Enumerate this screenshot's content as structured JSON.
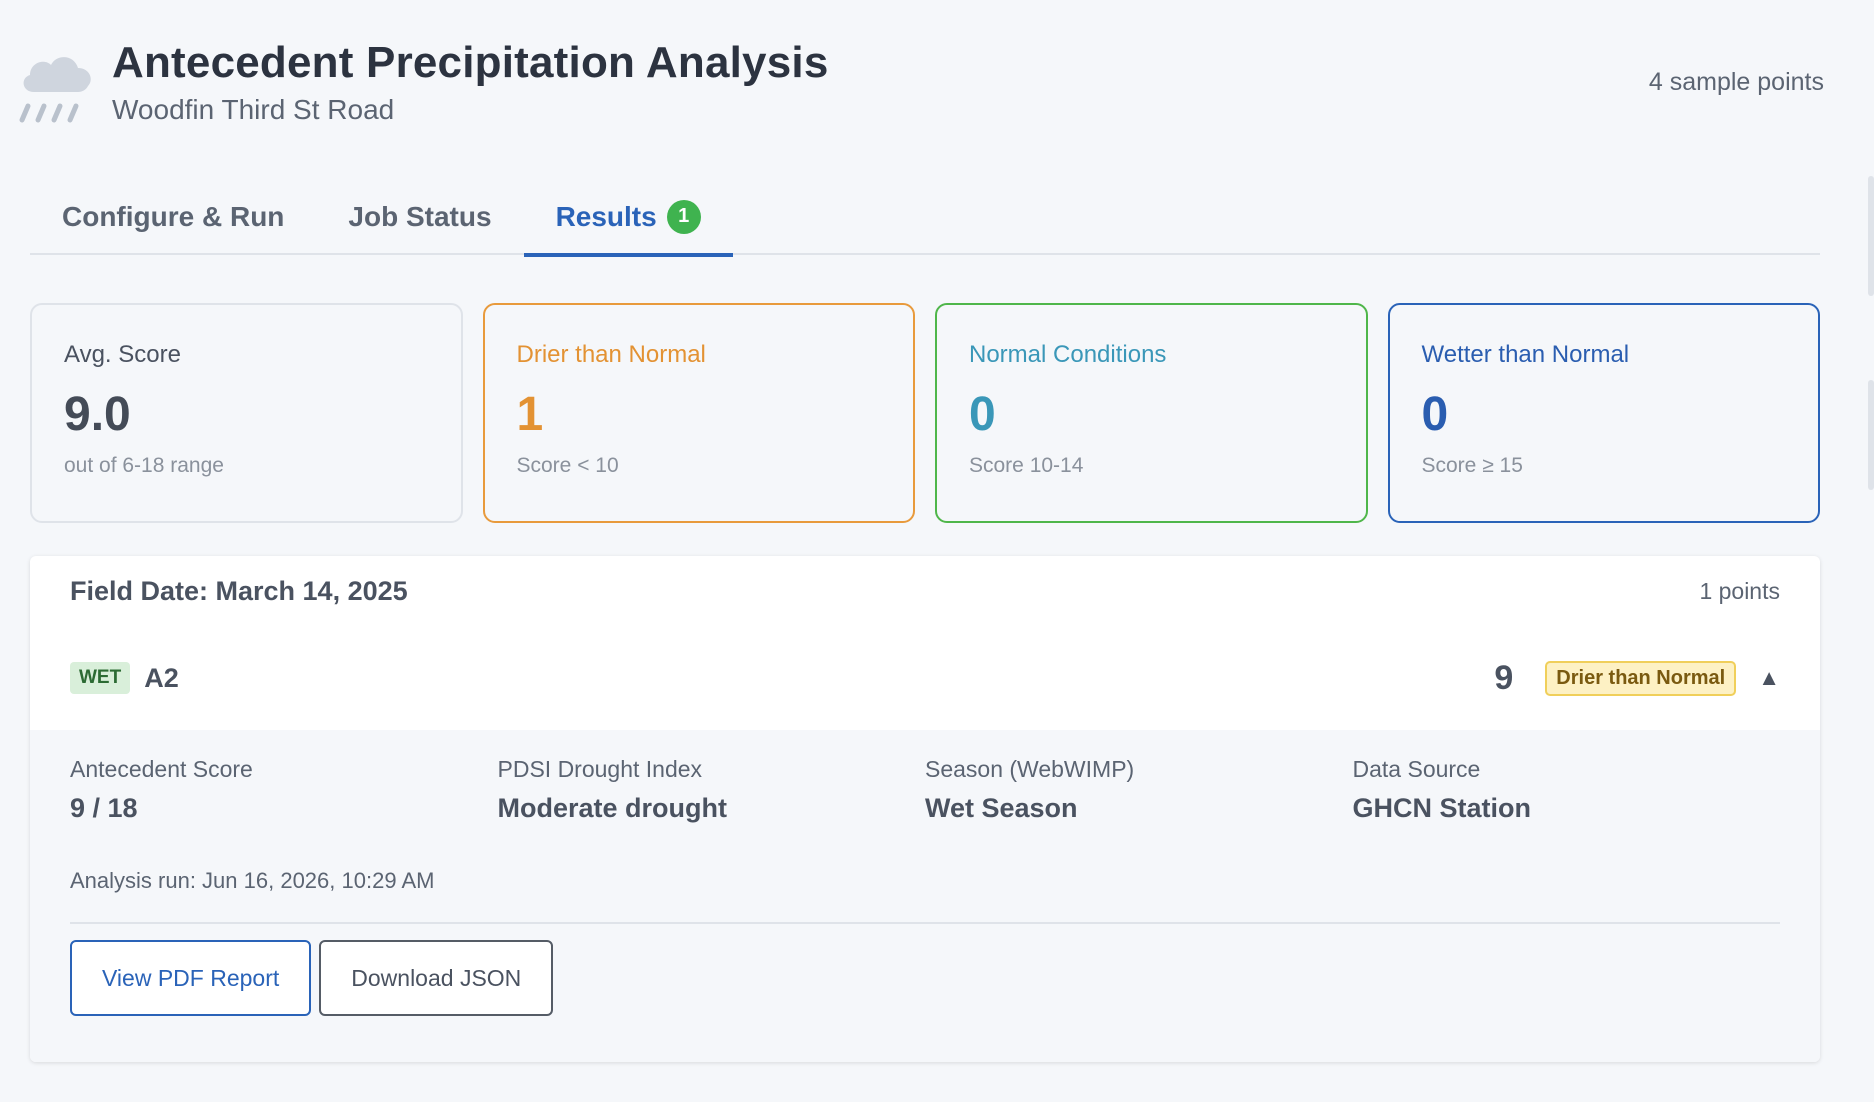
{
  "header": {
    "title": "Antecedent Precipitation Analysis",
    "subtitle": "Woodfin Third St Road",
    "sample_count": "4 sample points",
    "icon": "cloud-rain-icon"
  },
  "tabs": [
    {
      "label": "Configure & Run",
      "active": false
    },
    {
      "label": "Job Status",
      "active": false
    },
    {
      "label": "Results",
      "active": true,
      "badge": "1"
    }
  ],
  "cards": {
    "avg": {
      "label": "Avg. Score",
      "value": "9.0",
      "note": "out of 6-18 range"
    },
    "dry": {
      "label": "Drier than Normal",
      "value": "1",
      "note": "Score < 10"
    },
    "normal": {
      "label": "Normal Conditions",
      "value": "0",
      "note": "Score 10-14"
    },
    "wet": {
      "label": "Wetter than Normal",
      "value": "0",
      "note": "Score ≥ 15"
    }
  },
  "panel": {
    "field_date": "Field Date: March 14, 2025",
    "points_count": "1 points",
    "row": {
      "tag": "WET",
      "name": "A2",
      "score": "9",
      "status": "Drier than Normal",
      "expand_glyph": "▲"
    },
    "details": {
      "antecedent_label": "Antecedent Score",
      "antecedent_value": "9 / 18",
      "pdsi_label": "PDSI Drought Index",
      "pdsi_value": "Moderate drought",
      "season_label": "Season (WebWIMP)",
      "season_value": "Wet Season",
      "source_label": "Data Source",
      "source_value": "GHCN Station",
      "analysis_run": "Analysis run: Jun 16, 2026, 10:29 AM"
    },
    "buttons": {
      "pdf": "View PDF Report",
      "json": "Download JSON"
    }
  },
  "colors": {
    "accent": "#2a63b8",
    "dry": "#e39233",
    "normal": "#3a97b8",
    "wet": "#2a5db0",
    "badge_green": "#3fb34f"
  }
}
